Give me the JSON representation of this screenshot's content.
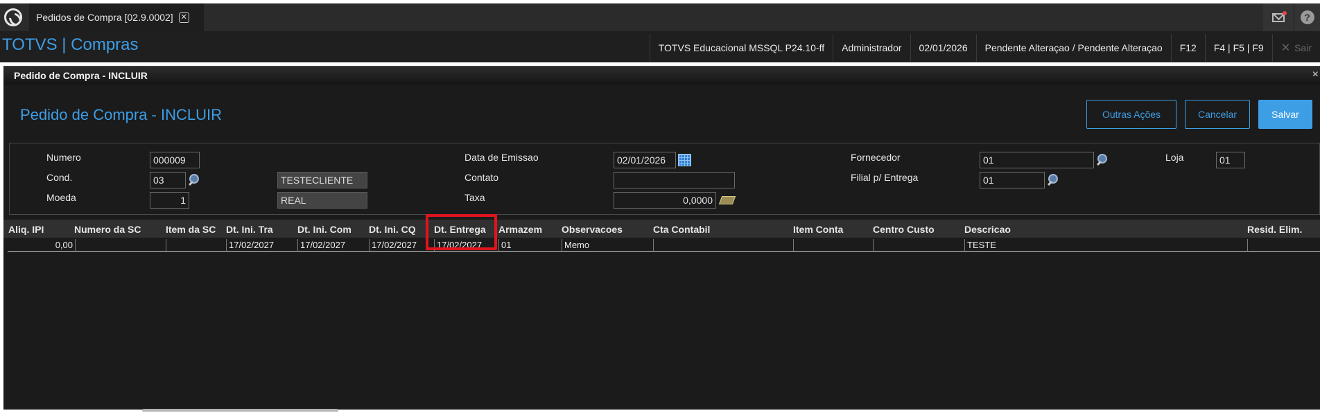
{
  "tab": {
    "label": "Pedidos de Compra [02.9.0002]",
    "close": "✕"
  },
  "header": {
    "brand": "TOTVS | Compras",
    "status": {
      "environment": "TOTVS Educacional MSSQL P24.10-ff",
      "user": "Administrador",
      "date": "02/01/2026",
      "pending": "Pendente Alteraçao / Pendente Alteraçao",
      "shortcut1": "F12",
      "shortcut2": "F4 | F5 | F9",
      "exit": "Sair"
    }
  },
  "dialog": {
    "title": "Pedido de Compra - INCLUIR",
    "close": "×",
    "page_title": "Pedido de Compra - INCLUIR",
    "buttons": {
      "other_actions": "Outras Ações",
      "cancel": "Cancelar",
      "save": "Salvar"
    }
  },
  "form": {
    "numero": {
      "label": "Numero",
      "value": "000009"
    },
    "cond": {
      "label": "Cond.",
      "value": "03",
      "description": "TESTECLIENTE"
    },
    "moeda": {
      "label": "Moeda",
      "value": "1",
      "description": "REAL"
    },
    "data_emissao": {
      "label": "Data de Emissao",
      "value": "02/01/2026"
    },
    "contato": {
      "label": "Contato",
      "value": ""
    },
    "taxa": {
      "label": "Taxa",
      "value": "0,0000"
    },
    "fornecedor": {
      "label": "Fornecedor",
      "value": "01"
    },
    "loja": {
      "label": "Loja",
      "value": "01"
    },
    "filial_entrega": {
      "label": "Filial p/ Entrega",
      "value": "01"
    }
  },
  "grid": {
    "columns": [
      "Aliq. IPI",
      "Numero da SC",
      "Item da SC",
      "Dt. Ini. Tra",
      "Dt. Ini. Com",
      "Dt. Ini. CQ",
      "Dt. Entrega",
      "Armazem",
      "Observacoes",
      "Cta Contabil",
      "Item Conta",
      "Centro Custo",
      "Descricao",
      "Resid. Elim."
    ],
    "rows": [
      [
        "0,00",
        "",
        "",
        "17/02/2027",
        "17/02/2027",
        "17/02/2027",
        "17/02/2027",
        "01",
        "Memo",
        "",
        "",
        "",
        "TESTE",
        ""
      ]
    ]
  },
  "colors": {
    "accent": "#3d9ee6",
    "highlight": "#e0141e",
    "background": "#1b1b1b"
  },
  "icons": [
    "app-logo-icon",
    "close-icon",
    "mail-icon",
    "help-icon",
    "lookup-icon",
    "calendar-icon",
    "money-icon"
  ]
}
